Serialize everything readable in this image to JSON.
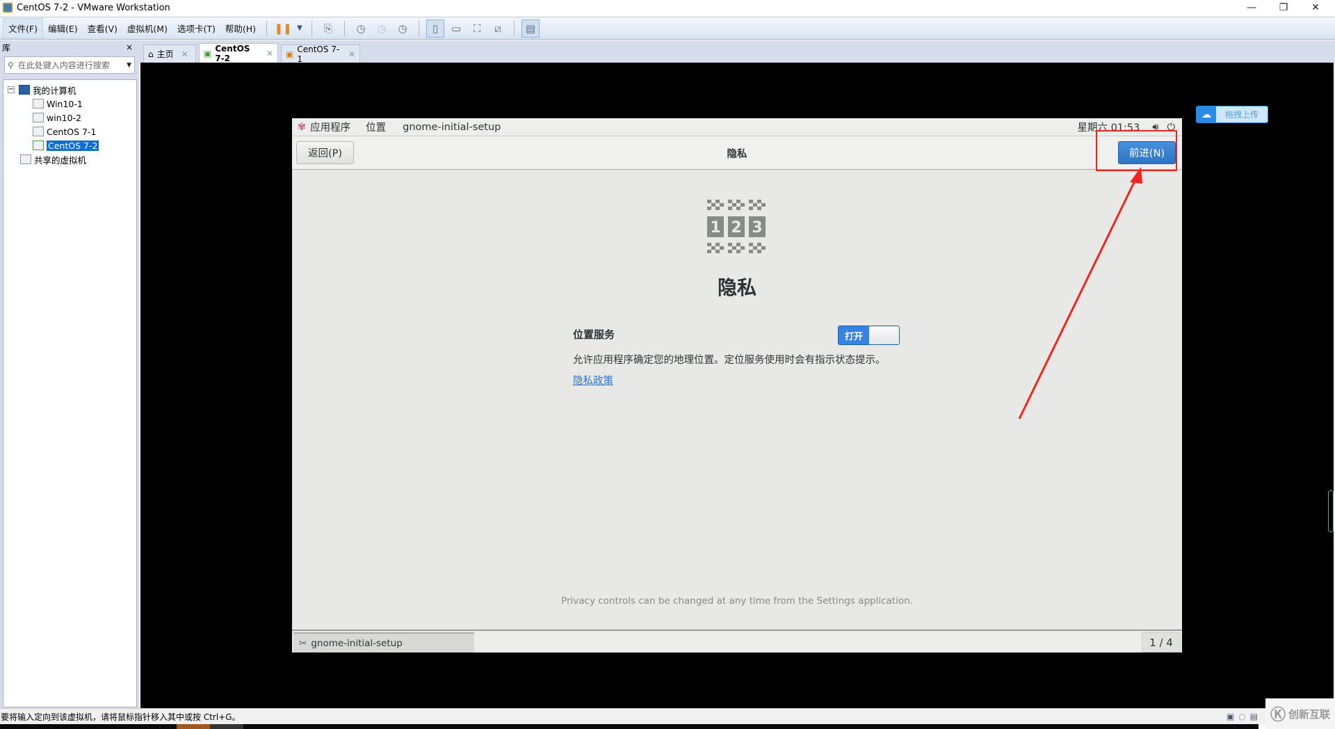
{
  "window": {
    "title": "CentOS 7-2 - VMware Workstation",
    "minimize": "—",
    "restore": "❐",
    "close": "✕"
  },
  "menu": [
    "文件(F)",
    "编辑(E)",
    "查看(V)",
    "虚拟机(M)",
    "选项卡(T)",
    "帮助(H)"
  ],
  "library": {
    "title": "库",
    "close": "×",
    "search_placeholder": "在此处键入内容进行搜索",
    "tree": {
      "root": "我的计算机",
      "vms": [
        "Win10-1",
        "win10-2",
        "CentOS 7-1",
        "CentOS 7-2"
      ],
      "shared": "共享的虚拟机"
    }
  },
  "tabs": [
    {
      "label": "主页"
    },
    {
      "label": "CentOS 7-2"
    },
    {
      "label": "CentOS 7-1"
    }
  ],
  "guest": {
    "topbar": {
      "apps": "应用程序",
      "places": "位置",
      "app": "gnome-initial-setup",
      "clock": "星期六 01:53"
    },
    "header": {
      "back": "返回(P)",
      "title": "隐私",
      "next": "前进(N)"
    },
    "page_title": "隐私",
    "location": {
      "label": "位置服务",
      "toggle": "打开",
      "toggle_on": true,
      "description": "允许应用程序确定您的地理位置。定位服务使用时会有指示状态提示。",
      "policy_link": "隐私政策"
    },
    "footer": "Privacy controls can be changed at any time from the Settings application.",
    "taskbar": {
      "item": "gnome-initial-setup",
      "pager": "1 / 4"
    }
  },
  "baidu": {
    "label": "拖拽上传"
  },
  "statusbar": {
    "text": "要将输入定向到该虚拟机，请将鼠标指针移入其中或按 Ctrl+G。"
  },
  "watermark": {
    "text": "创新互联"
  },
  "colors": {
    "accent": "#3584e4",
    "annotation": "#f0241a"
  }
}
